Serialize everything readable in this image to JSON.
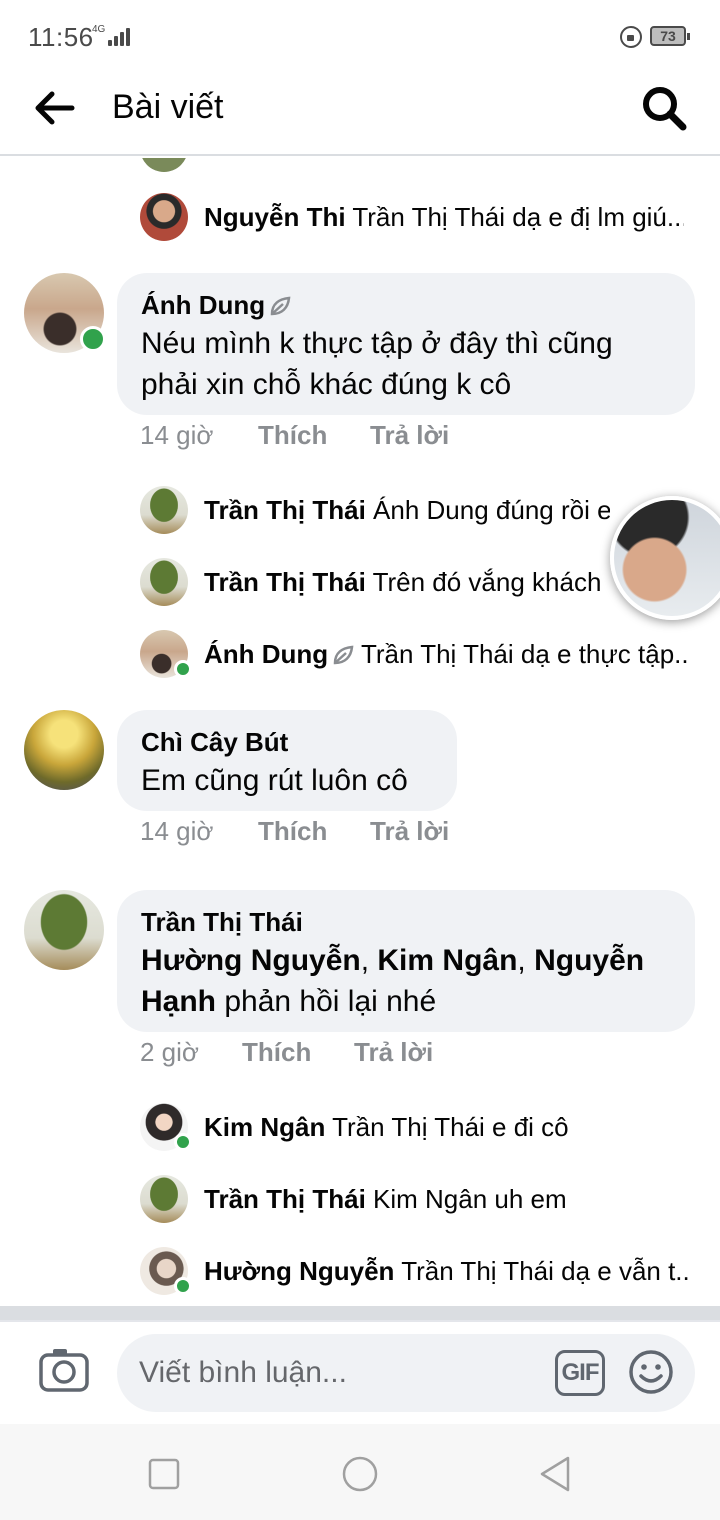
{
  "status_bar": {
    "time": "11:56",
    "network": "4G",
    "battery": "73"
  },
  "header": {
    "title": "Bài viết",
    "back_icon": "arrow-left-icon",
    "search_icon": "search-icon"
  },
  "top_replies": [
    {
      "name": "Nguyễn Thi",
      "text": "Trần Thị Thái dạ e đị lm giú..."
    }
  ],
  "comments": [
    {
      "name": "Ánh Dung",
      "badge_icon": "leaf-icon",
      "text": "Néu mình k thực tập ở đây thì cũng phải xin chỗ khác đúng k cô",
      "time": "14 giờ",
      "like": "Thích",
      "reply": "Trả lời",
      "online": true,
      "replies": [
        {
          "name": "Trần Thị Thái",
          "text": "Ánh Dung đúng rồi e",
          "online": false
        },
        {
          "name": "Trần Thị Thái",
          "text": "Trên đó vắng khách l",
          "online": false
        },
        {
          "name": "Ánh Dung",
          "text": "Trần Thị Thái dạ e thực tập...",
          "online": true
        }
      ]
    },
    {
      "name": "Chì Cây Bút",
      "text": "Em cũng rút luôn cô",
      "time": "14 giờ",
      "like": "Thích",
      "reply": "Trả lời",
      "online": false,
      "replies": []
    },
    {
      "name": "Trần Thị Thái",
      "mentions": [
        "Hường Nguyễn",
        "Kim Ngân",
        "Nguyễn Hạnh"
      ],
      "mention_sep": ", ",
      "text_rest": " phản hồi lại nhé",
      "time": "2 giờ",
      "like": "Thích",
      "reply": "Trả lời",
      "online": false,
      "replies": [
        {
          "name": "Kim Ngân",
          "text": "Trần Thị Thái e đi cô",
          "online": true
        },
        {
          "name": "Trần Thị Thái",
          "text": "Kim Ngân uh em",
          "online": false
        },
        {
          "name": "Hường Nguyễn",
          "text": "Trần Thị Thái dạ e vẫn t...",
          "online": true
        }
      ]
    }
  ],
  "composer": {
    "placeholder": "Viết bình luận...",
    "gif_label": "GIF",
    "camera_icon": "camera-icon",
    "emoji_icon": "emoji-icon"
  },
  "colors": {
    "online": "#31a24c",
    "bubble": "#f0f2f5",
    "meta": "#8a8d91",
    "divider": "#dadde1"
  }
}
